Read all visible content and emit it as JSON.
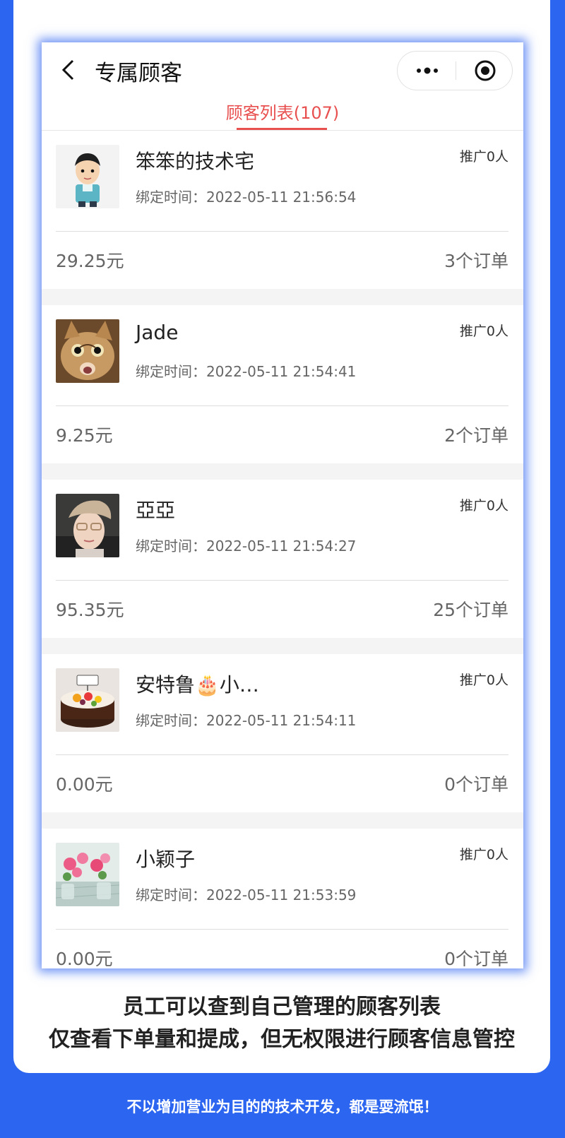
{
  "header": {
    "title": "专属顾客",
    "tab": "顾客列表(107)"
  },
  "colors": {
    "accent": "#e8504f",
    "background": "#2b65f0"
  },
  "customers": [
    {
      "name": "笨笨的技术宅",
      "bind_time": "绑定时间：2022-05-11 21:56:54",
      "promo": "推广0人",
      "amount": "29.25元",
      "orders": "3个订单",
      "avatar_icon": "cartoon-man-avatar"
    },
    {
      "name": "Jade",
      "bind_time": "绑定时间：2022-05-11 21:54:41",
      "promo": "推广0人",
      "amount": "9.25元",
      "orders": "2个订单",
      "avatar_icon": "cat-avatar"
    },
    {
      "name": "亞亞",
      "bind_time": "绑定时间：2022-05-11 21:54:27",
      "promo": "推广0人",
      "amount": "95.35元",
      "orders": "25个订单",
      "avatar_icon": "woman-cap-avatar"
    },
    {
      "name": "安特鲁🎂小…",
      "bind_time": "绑定时间：2022-05-11 21:54:11",
      "promo": "推广0人",
      "amount": "0.00元",
      "orders": "0个订单",
      "avatar_icon": "cake-avatar"
    },
    {
      "name": "小颖子",
      "bind_time": "绑定时间：2022-05-11 21:53:59",
      "promo": "推广0人",
      "amount": "0.00元",
      "orders": "0个订单",
      "avatar_icon": "flowers-avatar"
    }
  ],
  "caption": {
    "line1": "员工可以查到自己管理的顾客列表",
    "line2": "仅查看下单量和提成，但无权限进行顾客信息管控"
  },
  "footer": "不以增加营业为目的的技术开发，都是耍流氓！"
}
